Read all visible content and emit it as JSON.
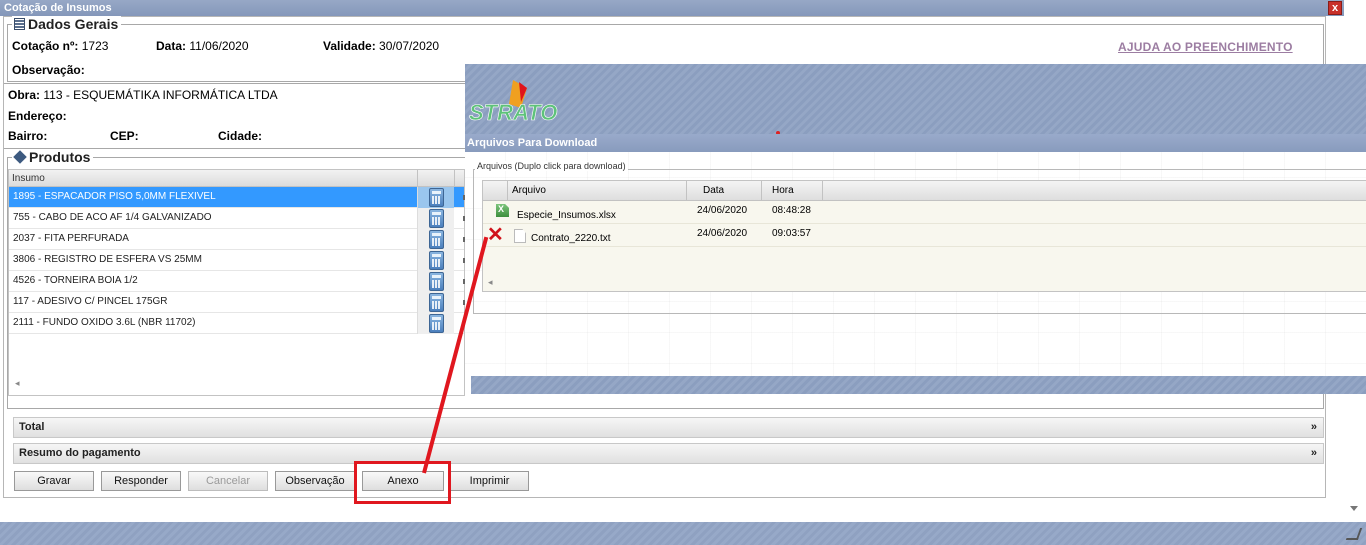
{
  "window": {
    "title": "Cotação de Insumos",
    "close": "x"
  },
  "dados_gerais": {
    "legend": "Dados Gerais",
    "cotacao_label": "Cotação nº:",
    "cotacao_value": "1723",
    "data_label": "Data:",
    "data_value": "11/06/2020",
    "validade_label": "Validade:",
    "validade_value": "30/07/2020",
    "observacao_label": "Observação:",
    "help_link": "AJUDA AO PREENCHIMENTO"
  },
  "obra": {
    "obra_label": "Obra:",
    "obra_value": "113 - ESQUEMÁTIKA INFORMÁTICA LTDA",
    "endereco_label": "Endereço:",
    "bairro_label": "Bairro:",
    "cep_label": "CEP:",
    "cidade_label": "Cidade:"
  },
  "produtos": {
    "legend": "Produtos",
    "column_insumo": "Insumo",
    "rows": [
      "1895 - ESPACADOR PISO 5,0MM FLEXIVEL",
      "755 - CABO DE ACO AF 1/4 GALVANIZADO",
      "2037 - FITA PERFURADA",
      "3806 - REGISTRO DE ESFERA VS 25MM",
      "4526 - TORNEIRA BOIA 1/2",
      "117 - ADESIVO C/ PINCEL 175GR",
      "2111 - FUNDO OXIDO 3.6L (NBR 11702)"
    ]
  },
  "panels": {
    "total": "Total",
    "resumo": "Resumo do pagamento",
    "expand": "»"
  },
  "buttons": {
    "gravar": "Gravar",
    "responder": "Responder",
    "cancelar": "Cancelar",
    "observacao": "Observação",
    "anexo": "Anexo",
    "imprimir": "Imprimir"
  },
  "popup": {
    "logo": "STRATO",
    "title": "Arquivos Para Download",
    "fieldset_legend": "Arquivos (Duplo click para download)",
    "columns": {
      "arquivo": "Arquivo",
      "data": "Data",
      "hora": "Hora"
    },
    "files": [
      {
        "name": "Especie_Insumos.xlsx",
        "date": "24/06/2020",
        "time": "08:48:28",
        "icon": "excel-file-icon"
      },
      {
        "name": "Contrato_2220.txt",
        "date": "24/06/2020",
        "time": "09:03:57",
        "icon": "text-file-icon",
        "mark": "✕"
      }
    ]
  },
  "colors": {
    "annotation_red": "#e0171f",
    "selection_blue": "#3399ff",
    "header_blue": "#8b9ebf"
  }
}
